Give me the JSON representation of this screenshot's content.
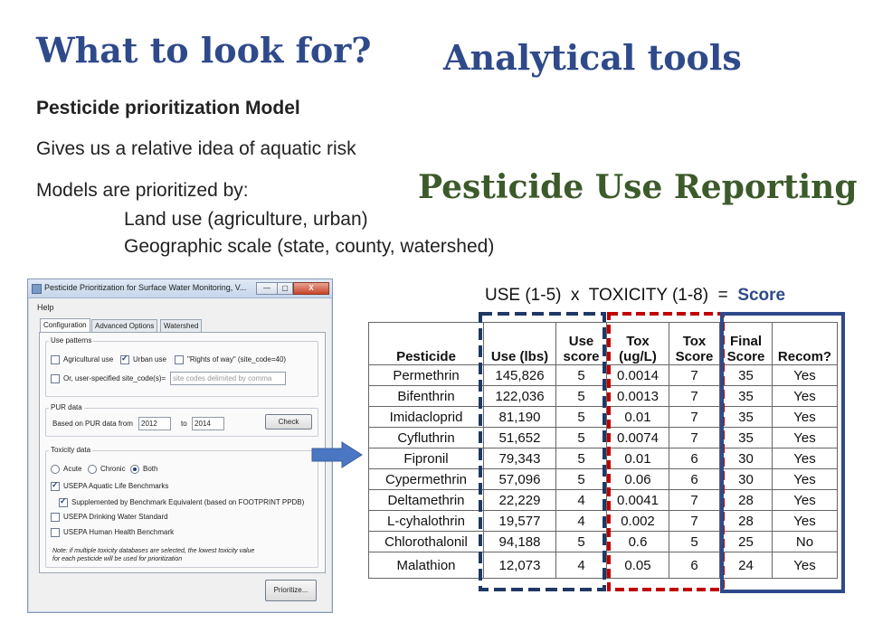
{
  "slide": {
    "title": "What to look for?",
    "subtitle_tools": "Analytical tools",
    "subtitle_pur": "Pesticide Use Reporting",
    "bullets": {
      "model": "Pesticide prioritization Model",
      "gives": "Gives us a relative idea of aquatic risk",
      "models_by": "Models are prioritized by:",
      "land_use": "Land use (agriculture, urban)",
      "geo_scale": "Geographic scale (state, county, watershed)"
    },
    "colors": {
      "title_blue": "#2f4a8a",
      "title_green": "#3c5a2a",
      "arrow": "#4a76c2",
      "dash_navy": "#1f3864",
      "dash_red": "#c00000",
      "solid_blue": "#2f4a8a"
    }
  },
  "window": {
    "title": "Pesticide Prioritization for Surface Water Monitoring, V...",
    "buttons": {
      "minimize": "—",
      "maximize": "▢",
      "close": "X"
    },
    "menu": "Help",
    "tabs": [
      "Configuration",
      "Advanced Options",
      "Watershed"
    ],
    "use_patterns": {
      "label": "Use patterns",
      "agricultural": "Agricultural use",
      "urban": "Urban use",
      "rights_of_way": "\"Rights of way\" (site_code=40)",
      "user_specified": "Or, user-specified site_code(s)=",
      "site_codes_placeholder": "site codes delimited by comma"
    },
    "pur": {
      "label": "PUR data",
      "based_on": "Based on PUR data from",
      "from_year": "2012",
      "to": "to",
      "to_year": "2014",
      "check_button": "Check"
    },
    "toxicity": {
      "label": "Toxicity data",
      "acute": "Acute",
      "chronic": "Chronic",
      "both": "Both",
      "usepa_aquatic": "USEPA Aquatic Life Benchmarks",
      "supplemented": "Supplemented by Benchmark Equivalent (based on FOOTPRINT PPDB)",
      "usepa_drinking": "USEPA Drinking Water Standard",
      "usepa_human": "USEPA Human Health Benchmark",
      "note": "Note: if multiple toxicity databases are selected, the lowest toxicity value",
      "note2": "for each pesticide will be used for prioritization"
    },
    "prioritize_button": "Prioritize..."
  },
  "formula": {
    "use": "USE (1-5)",
    "x": "x",
    "tox": "TOXICITY (1-8)",
    "eq": "=",
    "score": "Score"
  },
  "table": {
    "headers": [
      [
        "Pesticide"
      ],
      [
        "Use (lbs)"
      ],
      [
        "Use",
        "score"
      ],
      [
        "Tox",
        "(ug/L)"
      ],
      [
        "Tox",
        "Score"
      ],
      [
        "Final",
        "Score"
      ],
      [
        "Recom?"
      ]
    ],
    "rows": [
      [
        "Permethrin",
        "145,826",
        "5",
        "0.0014",
        "7",
        "35",
        "Yes"
      ],
      [
        "Bifenthrin",
        "122,036",
        "5",
        "0.0013",
        "7",
        "35",
        "Yes"
      ],
      [
        "Imidacloprid",
        "81,190",
        "5",
        "0.01",
        "7",
        "35",
        "Yes"
      ],
      [
        "Cyfluthrin",
        "51,652",
        "5",
        "0.0074",
        "7",
        "35",
        "Yes"
      ],
      [
        "Fipronil",
        "79,343",
        "5",
        "0.01",
        "6",
        "30",
        "Yes"
      ],
      [
        "Cypermethrin",
        "57,096",
        "5",
        "0.06",
        "6",
        "30",
        "Yes"
      ],
      [
        "Deltamethrin",
        "22,229",
        "4",
        "0.0041",
        "7",
        "28",
        "Yes"
      ],
      [
        "L-cyhalothrin",
        "19,577",
        "4",
        "0.002",
        "7",
        "28",
        "Yes"
      ],
      [
        "Chlorothalonil",
        "94,188",
        "5",
        "0.6",
        "5",
        "25",
        "No"
      ],
      [
        "Malathion",
        "12,073",
        "4",
        "0.05",
        "6",
        "24",
        "Yes"
      ]
    ]
  }
}
